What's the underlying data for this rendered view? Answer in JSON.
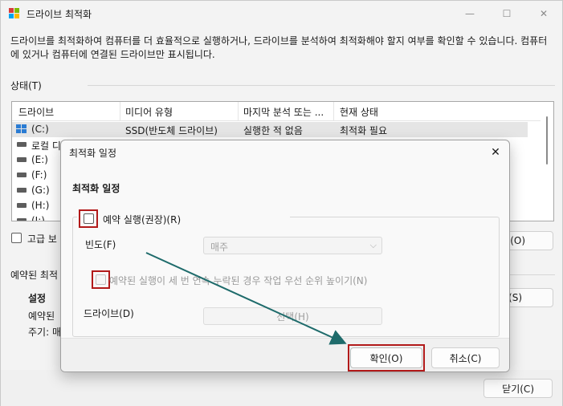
{
  "window": {
    "title": "드라이브 최적화",
    "description": "드라이브를 최적화하여 컴퓨터를 더 효율적으로 실행하거나, 드라이브를 분석하여 최적화해야 할지 여부를 확인할 수 있습니다. 컴퓨터에 있거나 컴퓨터에 연결된 드라이브만 표시됩니다.",
    "status_label": "상태(T)",
    "columns": [
      "드라이브",
      "미디어 유형",
      "마지막 분석 또는 ...",
      "현재 상태"
    ],
    "drives": [
      {
        "name": "(C:)",
        "media": "SSD(반도체 드라이브)",
        "last": "실행한 적 없음",
        "status": "최적화 필요"
      },
      {
        "name": "로컬 디",
        "media": "",
        "last": "",
        "status": ""
      },
      {
        "name": "(E:)",
        "media": "",
        "last": "",
        "status": ""
      },
      {
        "name": "(F:)",
        "media": "",
        "last": "",
        "status": ""
      },
      {
        "name": "(G:)",
        "media": "",
        "last": "",
        "status": ""
      },
      {
        "name": "(H:)",
        "media": "",
        "last": "",
        "status": ""
      },
      {
        "name": "(I:)",
        "media": "",
        "last": "",
        "status": ""
      }
    ],
    "advanced_label": "고급 보",
    "optimize_btn": "-(O)",
    "scheduled_label": "예약된 최적",
    "settings_label": "설정",
    "scheduled_run": "예약된",
    "frequency_line": "주기: 매",
    "change_settings_btn": "(S)",
    "close_btn": "닫기(C)"
  },
  "dialog": {
    "title": "최적화 일정",
    "heading": "최적화 일정",
    "schedule_checkbox": "예약 실행(권장)(R)",
    "frequency_label": "빈도(F)",
    "frequency_value": "매주",
    "increase_priority": "예약된 실행이 세 번 연속 누락된 경우 작업 우선 순위 높이기(N)",
    "drives_label": "드라이브(D)",
    "select_btn": "선택(H)",
    "ok_btn": "확인(O)",
    "cancel_btn": "취소(C)"
  },
  "colors": {
    "highlight": "#b21a1a",
    "arrow": "#1e6b6b"
  }
}
